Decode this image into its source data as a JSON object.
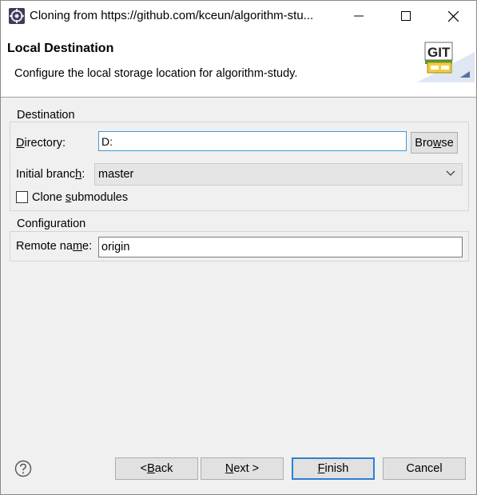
{
  "window": {
    "title": "Cloning from https://github.com/kceun/algorithm-stu..."
  },
  "banner": {
    "title": "Local Destination",
    "description": "Configure the local storage location for algorithm-study.",
    "logo_text": "GIT"
  },
  "destination": {
    "group_label": "Destination",
    "directory_label_pre": "",
    "directory_label_u": "D",
    "directory_label_post": "irectory:",
    "directory_value": "D:",
    "browse_pre": "Bro",
    "browse_u": "w",
    "browse_post": "se",
    "branch_label_pre": "Initial branc",
    "branch_label_u": "h",
    "branch_label_post": ":",
    "branch_value": "master",
    "clone_sub_pre": "Clone ",
    "clone_sub_u": "s",
    "clone_sub_post": "ubmodules",
    "clone_submodules_checked": false
  },
  "configuration": {
    "group_label": "Configuration",
    "remote_label_pre": "Remote na",
    "remote_label_u": "m",
    "remote_label_post": "e:",
    "remote_value": "origin"
  },
  "footer": {
    "back_pre": "< ",
    "back_u": "B",
    "back_post": "ack",
    "next_pre": "",
    "next_u": "N",
    "next_post": "ext >",
    "finish_pre": "",
    "finish_u": "F",
    "finish_post": "inish",
    "cancel": "Cancel"
  },
  "colors": {
    "focus_border": "#3c9bd6",
    "default_button_border": "#2f7fd1"
  }
}
